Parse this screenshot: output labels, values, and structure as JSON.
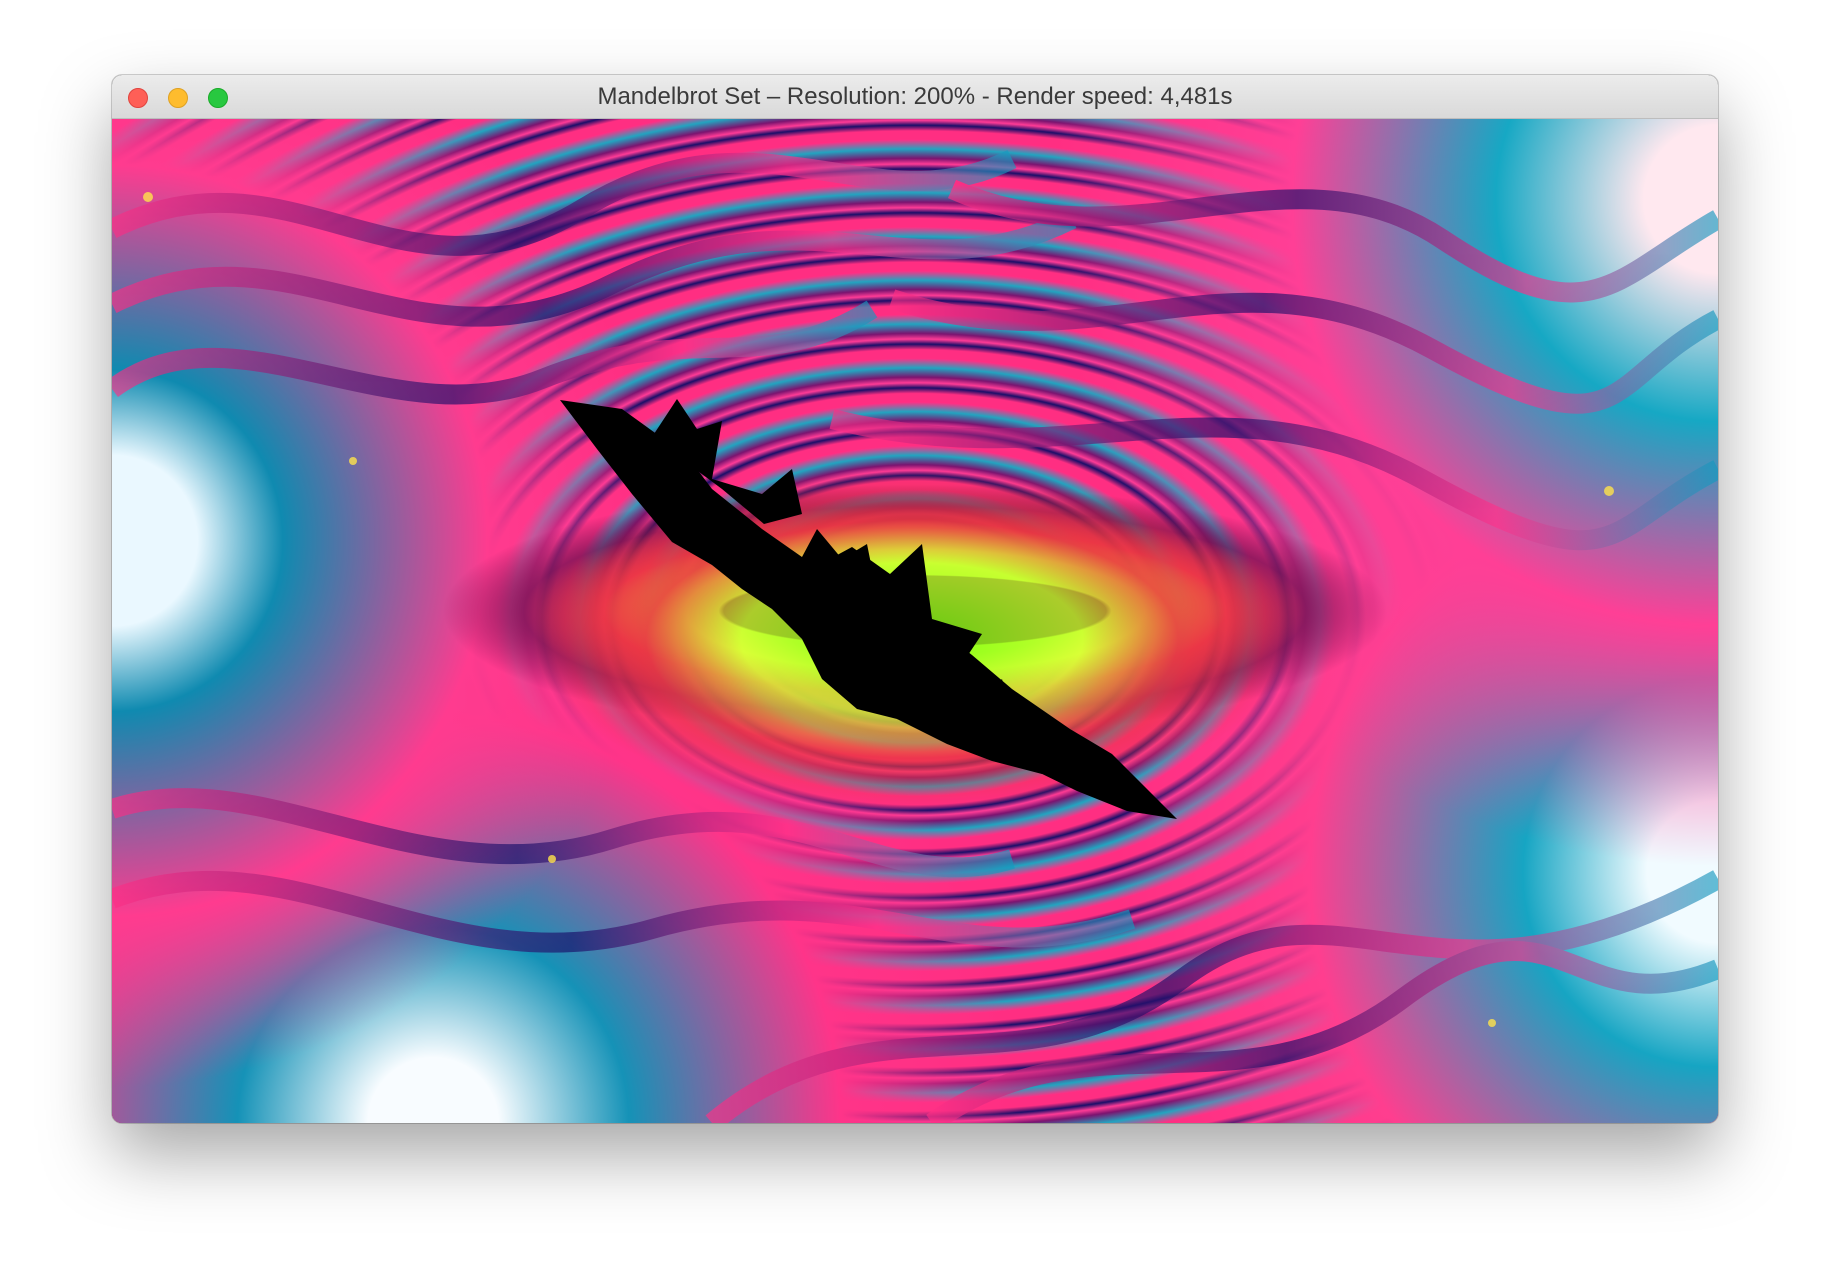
{
  "window": {
    "title": "Mandelbrot Set – Resolution: 200% - Render speed: 4,481s"
  },
  "traffic_lights": {
    "close": "close-button",
    "minimize": "minimize-button",
    "zoom": "zoom-button"
  },
  "colors": {
    "titlebar": "#e8e8e8",
    "title_text": "#3a3a3a",
    "fractal_pink": "#ff2f86",
    "fractal_blue": "#159fc0",
    "fractal_green": "#86ff16",
    "fractal_black": "#000000"
  }
}
